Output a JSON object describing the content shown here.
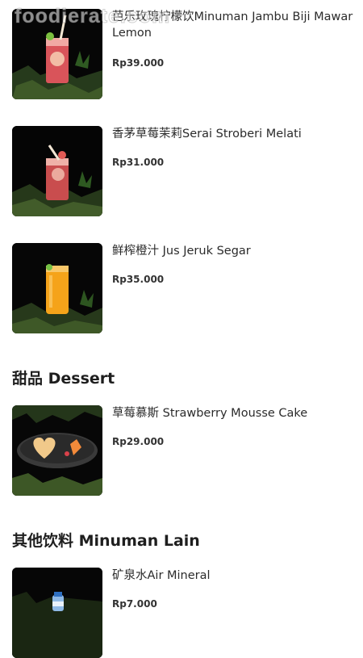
{
  "watermark": "foodierate.com",
  "items_top": [
    {
      "name": "芭乐玫瑰柠檬饮Minuman Jambu Biji Mawar Lemon",
      "price": "Rp39.000",
      "image": "pink-drink-photo"
    },
    {
      "name": "香茅草莓茉莉Serai Stroberi Melati",
      "price": "Rp31.000",
      "image": "strawberry-drink-photo"
    },
    {
      "name": "鲜榨橙汁 Jus Jeruk Segar",
      "price": "Rp35.000",
      "image": "orange-juice-photo"
    }
  ],
  "sections": [
    {
      "title": "甜品 Dessert",
      "items": [
        {
          "name": "草莓慕斯 Strawberry Mousse Cake",
          "price": "Rp29.000",
          "image": "mousse-cake-photo"
        }
      ]
    },
    {
      "title": "其他饮料 Minuman Lain",
      "items": [
        {
          "name": "矿泉水Air Mineral",
          "price": "Rp7.000",
          "image": "water-bottle-photo"
        }
      ]
    }
  ]
}
